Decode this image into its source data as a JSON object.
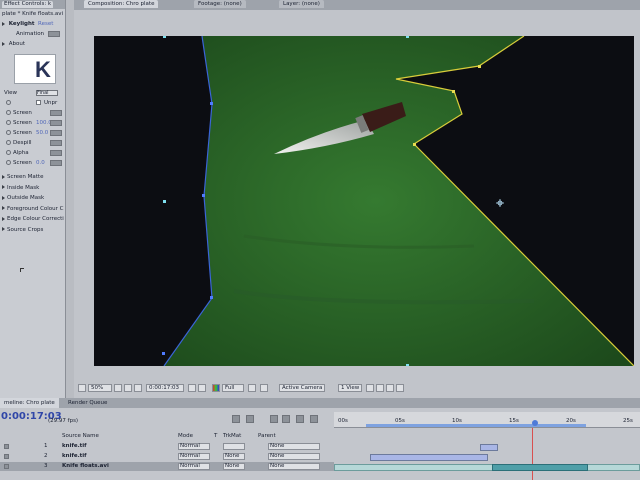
{
  "effects_panel": {
    "tab_label": "Effect Controls: k",
    "title": "plate * Knife floats.avi",
    "effect_name": "Keylight",
    "reset": "Reset",
    "animation": "Animation",
    "about": "About",
    "logo_letter": "K",
    "view_label": "View",
    "view_value": "Final",
    "unpremultiply": "Unpr",
    "params": [
      {
        "label": "Screen",
        "value": ""
      },
      {
        "label": "Screen",
        "value": "100.0"
      },
      {
        "label": "Screen",
        "value": "50.0"
      },
      {
        "label": "Despill",
        "value": ""
      },
      {
        "label": "Alpha",
        "value": ""
      },
      {
        "label": "Screen",
        "value": "0.0"
      }
    ],
    "groups": [
      "Screen Matte",
      "Inside Mask",
      "Outside Mask",
      "Foreground Colour C",
      "Edge Colour Correcti",
      "Source Crops"
    ]
  },
  "viewer": {
    "tabs": [
      "Composition: Chro plate",
      "Footage: (none)",
      "Layer: (none)"
    ],
    "toolbar": {
      "zoom": "50%",
      "timecode": "0:00:17:03",
      "resolution": "Full",
      "camera": "Active Camera",
      "views": "1 View"
    }
  },
  "timeline": {
    "tabs": [
      "meline: Chro plate",
      "Render Queue"
    ],
    "timecode": "0:00:17:03",
    "fps": "(29.97 fps)",
    "headers": {
      "source": "Source Name",
      "mode": "Mode",
      "t": "T",
      "trkmat": "TrkMat",
      "parent": "Parent"
    },
    "ruler_ticks": [
      "00s",
      "05s",
      "10s",
      "15s",
      "20s",
      "25s"
    ],
    "layers": [
      {
        "num": "1",
        "name": "knife.tif",
        "mode": "Normal",
        "trkmat": "",
        "parent": "None"
      },
      {
        "num": "2",
        "name": "knife.tif",
        "mode": "Normal",
        "trkmat": "None",
        "parent": "None"
      },
      {
        "num": "3",
        "name": "Knife floats.avi",
        "mode": "Normal",
        "trkmat": "None",
        "parent": "None"
      }
    ]
  },
  "colors": {
    "green_screen": "#2f6a2a",
    "mask_blue": "#3a64d8",
    "mask_yellow": "#d8cc3a",
    "timecode": "#2f46a8"
  }
}
